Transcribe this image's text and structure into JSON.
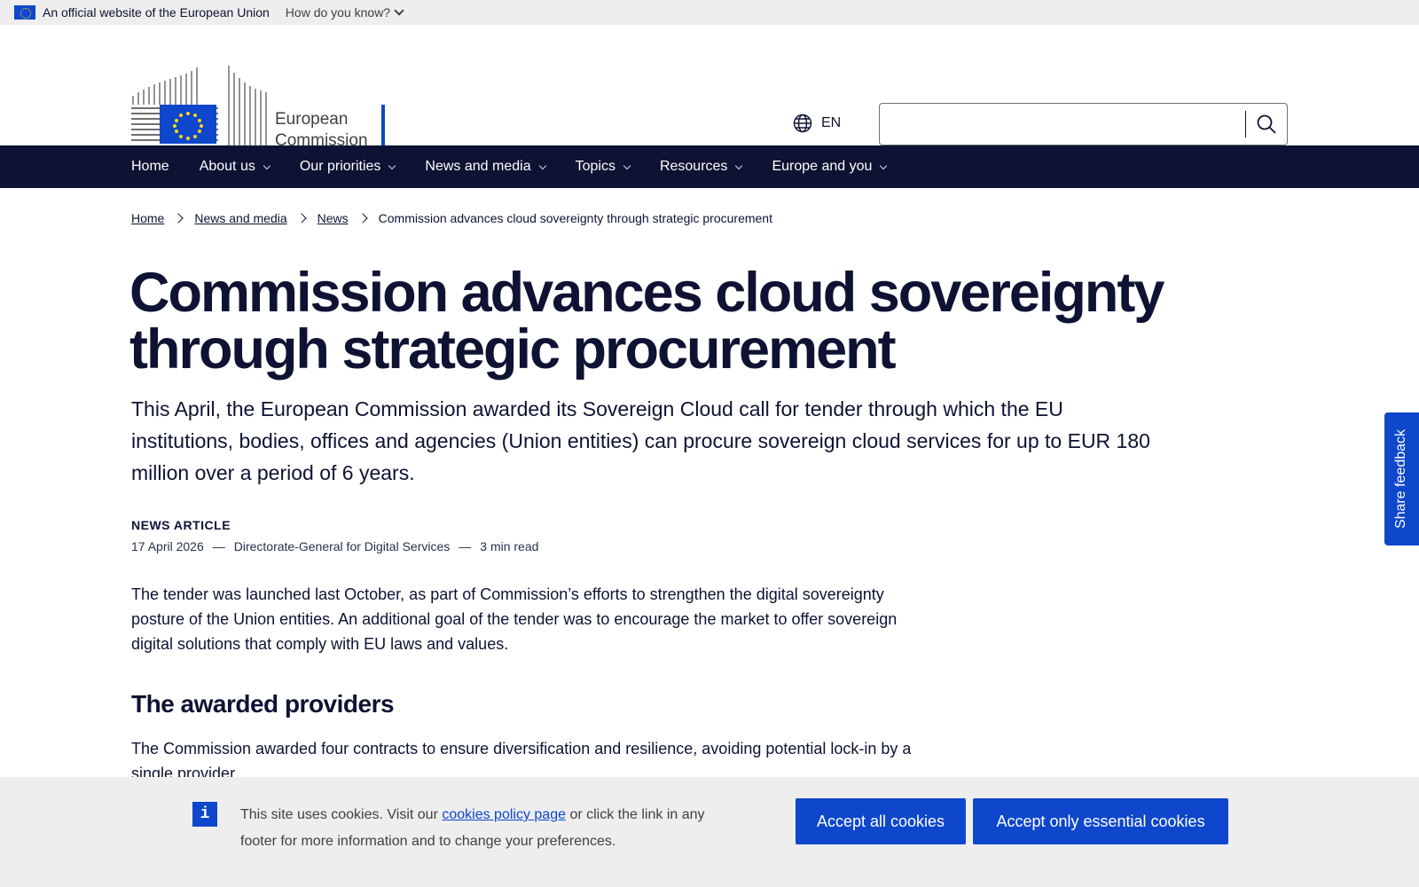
{
  "eu_bar": {
    "official_text": "An official website of the European Union",
    "how_do_you_know": "How do you know?"
  },
  "header": {
    "logo_line1": "European",
    "logo_line2": "Commission",
    "language": "EN",
    "search_placeholder": ""
  },
  "nav": {
    "items": [
      {
        "label": "Home"
      },
      {
        "label": "About us"
      },
      {
        "label": "Our priorities"
      },
      {
        "label": "News and media"
      },
      {
        "label": "Topics"
      },
      {
        "label": "Resources"
      },
      {
        "label": "Europe and you"
      }
    ]
  },
  "breadcrumb": {
    "items": [
      "Home",
      "News and media",
      "News"
    ],
    "current": "Commission advances cloud sovereignty through strategic procurement"
  },
  "article": {
    "title_line1": "Commission advances cloud sovereignty",
    "title_line2": "through strategic procurement",
    "lead": "This April, the European Commission awarded its Sovereign Cloud call for tender through which the EU institutions, bodies, offices and agencies (Union entities) can procure sovereign cloud services for up to EUR 180 million over a period of 6 years.",
    "type": "NEWS ARTICLE",
    "date": "17 April 2026",
    "department": "Directorate-General for Digital Services",
    "read_time": "3 min read",
    "sep": "—",
    "paragraph1": "The tender was launched last October, as part of Commission’s efforts to strengthen the digital sovereignty posture of the Union entities. An additional goal of the tender was to encourage the market to offer sovereign digital solutions that comply with EU laws and values.",
    "heading_providers": "The awarded providers",
    "paragraph2": "The Commission awarded four contracts to ensure diversification and resilience, avoiding potential lock-in by a single provider."
  },
  "feedback": {
    "label": "Share feedback"
  },
  "cookie": {
    "text_before": "This site uses cookies. Visit our ",
    "link": "cookies policy page",
    "text_after": " or click the link in any footer for more information and to change your preferences.",
    "accept_all": "Accept all cookies",
    "accept_essential": "Accept only essential cookies"
  },
  "colors": {
    "primary_blue": "#0e47cb",
    "navy": "#0e1333",
    "flag_yellow": "#ffd617",
    "banner_grey": "#eeeeee"
  }
}
